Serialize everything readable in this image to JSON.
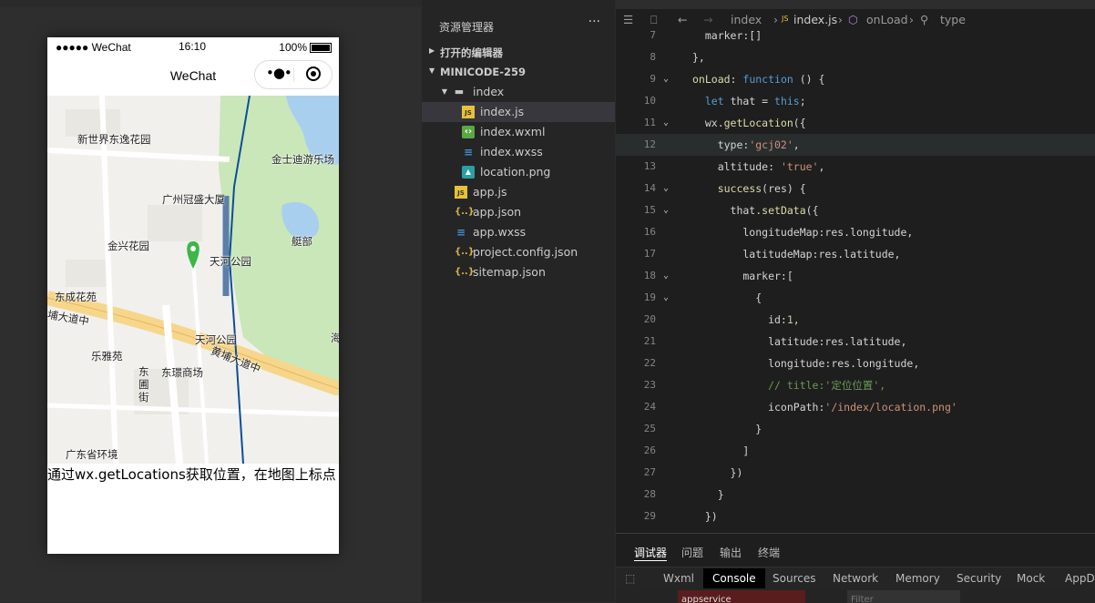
{
  "simulator": {
    "status": {
      "signal": "●●●●● WeChat",
      "time": "16:10",
      "battery": "100%"
    },
    "nav_title": "WeChat",
    "capsule_dots": "•●•",
    "map_labels": [
      {
        "text": "新世界东逸花园"
      },
      {
        "text": "金士迪游乐场"
      },
      {
        "text": "广州冠盛大厦"
      },
      {
        "text": "金兴花园"
      },
      {
        "text": "艇部"
      },
      {
        "text": "天河公园"
      },
      {
        "text": "东成花苑"
      },
      {
        "text": "埔大道中"
      },
      {
        "text": "天河公园"
      },
      {
        "text": "乐雅苑"
      },
      {
        "text": "东璟商场"
      },
      {
        "text": "黄埔大道中"
      },
      {
        "text": "东 圃 街"
      },
      {
        "text": "广东省环境"
      },
      {
        "text": "海"
      }
    ],
    "description": "通过wx.getLocations获取位置，在地图上标点"
  },
  "explorer": {
    "title": "资源管理器",
    "more": "···",
    "open_editors": "打开的编辑器",
    "project": "MINICODE-259",
    "tree": [
      {
        "label": "index",
        "icon": "folder-icon",
        "selected": false
      },
      {
        "label": "index.js",
        "icon": "js-icon",
        "selected": true
      },
      {
        "label": "index.wxml",
        "icon": "wxml-icon",
        "selected": false
      },
      {
        "label": "index.wxss",
        "icon": "wxss-icon",
        "selected": false
      },
      {
        "label": "location.png",
        "icon": "image-icon",
        "selected": false
      },
      {
        "label": "app.js",
        "icon": "js-icon",
        "selected": false
      },
      {
        "label": "app.json",
        "icon": "json-icon",
        "selected": false
      },
      {
        "label": "app.wxss",
        "icon": "wxss-icon",
        "selected": false
      },
      {
        "label": "project.config.json",
        "icon": "json-icon",
        "selected": false
      },
      {
        "label": "sitemap.json",
        "icon": "json-icon",
        "selected": false
      }
    ]
  },
  "editor": {
    "breadcrumb": [
      "index",
      "index.js",
      "onLoad",
      "type"
    ],
    "lines": [
      {
        "n": "7",
        "text": "  marker:[]",
        "fold": false
      },
      {
        "n": "8",
        "text": "},",
        "fold": false
      },
      {
        "n": "9",
        "text": "onLoad: function () {",
        "fold": true
      },
      {
        "n": "10",
        "text": "  let that = this;",
        "fold": false
      },
      {
        "n": "11",
        "text": "  wx.getLocation({",
        "fold": true
      },
      {
        "n": "12",
        "text": "    type:'gcj02',",
        "fold": false
      },
      {
        "n": "13",
        "text": "    altitude: 'true',",
        "fold": false
      },
      {
        "n": "14",
        "text": "    success(res) {",
        "fold": true
      },
      {
        "n": "15",
        "text": "      that.setData({",
        "fold": true
      },
      {
        "n": "16",
        "text": "        longitudeMap:res.longitude,",
        "fold": false
      },
      {
        "n": "17",
        "text": "        latitudeMap:res.latitude,",
        "fold": false
      },
      {
        "n": "18",
        "text": "        marker:[",
        "fold": true
      },
      {
        "n": "19",
        "text": "          {",
        "fold": true
      },
      {
        "n": "20",
        "text": "            id:1,",
        "fold": false
      },
      {
        "n": "21",
        "text": "            latitude:res.latitude,",
        "fold": false
      },
      {
        "n": "22",
        "text": "            longitude:res.longitude,",
        "fold": false
      },
      {
        "n": "23",
        "text": "            // title:'定位位置',",
        "fold": false
      },
      {
        "n": "24",
        "text": "            iconPath:'/index/location.png'",
        "fold": false
      },
      {
        "n": "25",
        "text": "          }",
        "fold": false
      },
      {
        "n": "26",
        "text": "        ]",
        "fold": false
      },
      {
        "n": "27",
        "text": "      })",
        "fold": false
      },
      {
        "n": "28",
        "text": "    }",
        "fold": false
      },
      {
        "n": "29",
        "text": "  })",
        "fold": false
      }
    ]
  },
  "devtools": {
    "top_tabs": [
      "调试器",
      "问题",
      "输出",
      "终端"
    ],
    "panel_tabs": [
      "Wxml",
      "Console",
      "Sources",
      "Network",
      "Memory",
      "Security",
      "Mock",
      "AppD"
    ],
    "active_panel": "Console",
    "context": "appservice",
    "filter_placeholder": "Filter"
  },
  "colors": {
    "keyword": "#569cd6",
    "string": "#ce9178",
    "comment": "#6a9955",
    "function": "#dcdcaa",
    "property": "#9cdcfe",
    "map_green": "#c9e7b8",
    "map_water": "#a9cfee",
    "road": "#f6d68b"
  }
}
